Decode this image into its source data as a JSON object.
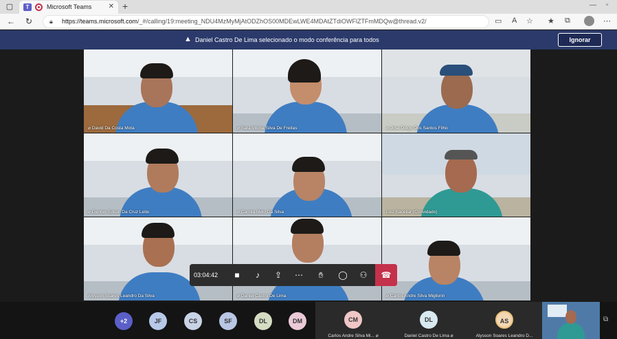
{
  "browser": {
    "tab_title": "Microsoft Teams",
    "tab_app_letter": "T",
    "url_host": "https://teams.microsoft.com",
    "url_path": "/_#/calling/19:meeting_NDU4MzMyMjAtODZhOS00MDEwLWE4MDAtZTdiOWFlZTFmMDQw@thread.v2/"
  },
  "banner": {
    "message": "Daniel Castro De Lima selecionado o modo conferência para todos",
    "ignore_label": "Ignorar"
  },
  "tiles": [
    {
      "name": "David Da Costa Mota"
    },
    {
      "name": "Sara Vitoria Silva De Freitas"
    },
    {
      "name": "Jose Diogo Dos Santos Filho"
    },
    {
      "name": "Denner Edson Da Cruz Leite"
    },
    {
      "name": "Camila Melo Da Silva"
    },
    {
      "name": "Luiz Bacellar (Convidado)"
    },
    {
      "name": "Alysson Soares Leandro Da Silva"
    },
    {
      "name": "Daniel Castro De Lima"
    },
    {
      "name": "Carlos Andre Silva Migliorin"
    }
  ],
  "controls": {
    "timer": "03:04:42"
  },
  "strip": {
    "overflow_count": "+2",
    "avatars": [
      {
        "initials": "JF",
        "color": "#b8c9e8"
      },
      {
        "initials": "CS",
        "color": "#c9d3e6"
      },
      {
        "initials": "SF",
        "color": "#b9c6e4"
      },
      {
        "initials": "DL",
        "color": "#d4dcc2"
      },
      {
        "initials": "DM",
        "color": "#ecc9d7"
      }
    ],
    "featured": [
      {
        "initials": "CM",
        "name": "Carlos Andre Silva Mi...",
        "color": "#f0c6c6"
      },
      {
        "initials": "DL",
        "name": "Daniel Castro De Lima",
        "color": "#d8e9ef"
      },
      {
        "initials": "AS",
        "name": "Alysson Soares Leandro D...",
        "color": "#f3d7b5"
      }
    ]
  },
  "colors": {
    "banner": "#2b3a6b",
    "hangup": "#c4314b",
    "accent": "#5b5fc7"
  }
}
